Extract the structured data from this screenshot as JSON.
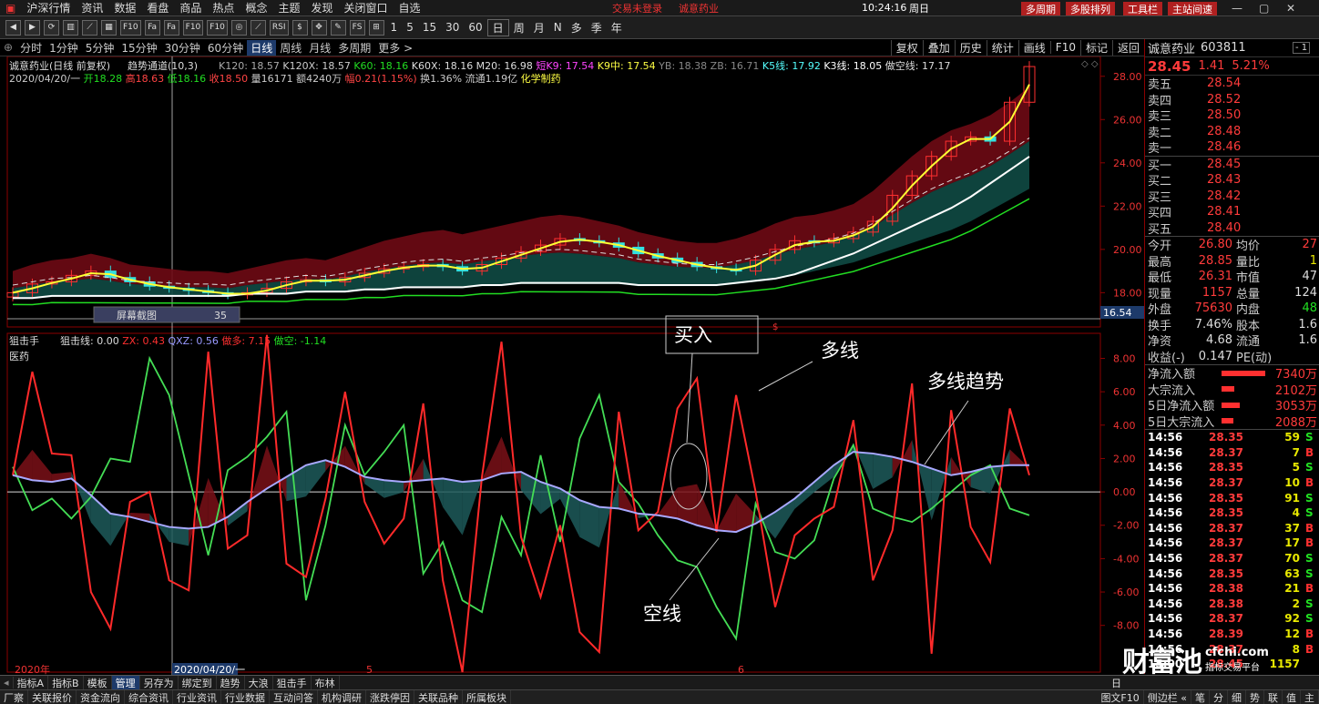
{
  "menu": {
    "items": [
      "沪深行情",
      "资讯",
      "数据",
      "看盘",
      "商品",
      "热点",
      "概念",
      "主题",
      "发现",
      "关闭窗口",
      "自选"
    ],
    "center_notice_1": "交易未登录",
    "center_notice_2": "诚意药业",
    "clock": "10:24:16",
    "weekday": "周日",
    "right_buttons": [
      "多周期",
      "多股排列",
      "工具栏",
      "主站间速"
    ]
  },
  "toolbar": {
    "icons": [
      "back-icon",
      "forward-icon",
      "refresh-icon",
      "candle-icon",
      "line-chart-icon",
      "grid-icon",
      "f10-icon",
      "fa-icon",
      "fa2-icon",
      "f10b-icon",
      "f10c-icon",
      "target-icon",
      "multi-chart-icon",
      "rsi-icon",
      "dollar-icon",
      "move-icon",
      "pencil-icon",
      "fs-icon",
      "cross-icon"
    ],
    "icon_labels": [
      "◀",
      "▶",
      "⟳",
      "▥",
      "⟋",
      "▦",
      "F10",
      "Fa",
      "Fa",
      "F10",
      "F10",
      "◎",
      "⟋",
      "RSI",
      "$",
      "✥",
      "✎",
      "FS",
      "⊞"
    ],
    "numbers": [
      "1",
      "5",
      "15",
      "30",
      "60"
    ],
    "periods": [
      "日",
      "周",
      "月",
      "N",
      "多",
      "季",
      "年"
    ]
  },
  "periodbar": {
    "items": [
      "分时",
      "1分钟",
      "5分钟",
      "15分钟",
      "30分钟",
      "60分钟",
      "日线",
      "周线",
      "月线",
      "多周期",
      "更多 >"
    ],
    "active": "日线",
    "right": [
      "复权",
      "叠加",
      "历史",
      "统计",
      "画线",
      "F10",
      "标记",
      "返回"
    ]
  },
  "main_chart": {
    "title_line": "诚意药业(日线 前复权)",
    "indicator": "趋势通道(10,3)",
    "params": [
      {
        "text": "K120: 18.57",
        "color": "#aaaaaa"
      },
      {
        "text": "K120X: 18.57",
        "color": "#cccccc"
      },
      {
        "text": "K60: 18.16",
        "color": "#22dd22"
      },
      {
        "text": "K60X: 18.16",
        "color": "#dddddd"
      },
      {
        "text": "M20: 16.98",
        "color": "#dddddd"
      },
      {
        "text": "短K9: 17.54",
        "color": "#ff44ff"
      },
      {
        "text": "K9中: 17.54",
        "color": "#ffff44"
      },
      {
        "text": "YB: 18.38",
        "color": "#888888"
      },
      {
        "text": "ZB: 16.71",
        "color": "#888888"
      },
      {
        "text": "K5线: 17.92",
        "color": "#55ffff"
      },
      {
        "text": "K3线: 18.05",
        "color": "#ffffff"
      },
      {
        "text": "做空线: 17.17",
        "color": "#dddddd"
      }
    ],
    "info_line": [
      {
        "text": "2020/04/20/一",
        "color": "#cccccc"
      },
      {
        "text": "开18.28",
        "color": "#22dd22"
      },
      {
        "text": "高18.63",
        "color": "#ff4444"
      },
      {
        "text": "低18.16",
        "color": "#22dd22"
      },
      {
        "text": "收18.50",
        "color": "#ff4444"
      },
      {
        "text": "量16171",
        "color": "#cccccc"
      },
      {
        "text": "额4240万",
        "color": "#cccccc"
      },
      {
        "text": "幅0.21(1.15%)",
        "color": "#ff4444"
      },
      {
        "text": "换1.36%",
        "color": "#cccccc"
      },
      {
        "text": "流通1.19亿",
        "color": "#cccccc"
      },
      {
        "text": "化学制药",
        "color": "#ffff44"
      }
    ],
    "y_ticks": [
      "28.00",
      "26.00",
      "24.00",
      "22.00",
      "20.00",
      "18.00"
    ],
    "cursor_price": "16.54",
    "screenshot_tip": "屏幕截图",
    "screenshot_num": "35"
  },
  "sub_chart": {
    "title": "狙击手",
    "label_2": "医药",
    "params": [
      {
        "text": "狙击线: 0.00",
        "color": "#dddddd"
      },
      {
        "text": "ZX: 0.43",
        "color": "#ff3030"
      },
      {
        "text": "QXZ: 0.56",
        "color": "#9999ff"
      },
      {
        "text": "做多: 7.15",
        "color": "#ff3030"
      },
      {
        "text": "做空: -1.14",
        "color": "#22dd22"
      }
    ],
    "y_ticks": [
      "8.00",
      "6.00",
      "4.00",
      "2.00",
      "0.00",
      "-2.00",
      "-4.00",
      "-6.00",
      "-8.00"
    ],
    "annotations": {
      "buy": "买入",
      "long": "多线",
      "long_trend": "多线趋势",
      "short": "空线"
    }
  },
  "x_axis": {
    "year": "2020年",
    "date": "2020/04/20/一",
    "m5": "5",
    "m6": "6"
  },
  "chart_data": {
    "type": "candlestick",
    "price_ylim": [
      16.5,
      29.0
    ],
    "osc_ylim": [
      -10.8,
      9.5
    ],
    "price_close": [
      18.0,
      18.4,
      18.5,
      18.8,
      19.0,
      18.7,
      18.5,
      18.3,
      18.2,
      18.1,
      18.0,
      17.9,
      18.0,
      18.2,
      18.5,
      18.6,
      18.5,
      18.7,
      18.9,
      19.1,
      19.2,
      19.3,
      19.2,
      19.0,
      19.3,
      19.6,
      19.9,
      20.2,
      20.5,
      20.4,
      20.3,
      20.1,
      19.8,
      19.6,
      19.4,
      19.2,
      19.1,
      19.0,
      19.5,
      20.0,
      20.4,
      20.3,
      20.5,
      20.8,
      21.3,
      22.5,
      23.4,
      24.3,
      25.0,
      25.2,
      25.0,
      26.8,
      28.45
    ],
    "upper_band": [
      19.0,
      19.3,
      19.5,
      19.6,
      19.8,
      19.6,
      19.3,
      19.2,
      19.1,
      19.0,
      19.0,
      18.9,
      19.1,
      19.3,
      19.5,
      19.6,
      19.5,
      19.8,
      20.1,
      20.4,
      20.6,
      20.8,
      20.9,
      20.7,
      20.9,
      21.1,
      21.3,
      21.5,
      21.6,
      21.5,
      21.3,
      21.1,
      20.8,
      20.6,
      20.4,
      20.3,
      20.3,
      20.5,
      20.8,
      21.2,
      21.5,
      21.6,
      21.8,
      22.1,
      22.7,
      23.5,
      24.3,
      25.0,
      25.5,
      25.8,
      26.2,
      26.8,
      27.5
    ],
    "lower_band": [
      17.7,
      17.7,
      17.8,
      17.8,
      17.8,
      17.8,
      17.8,
      17.8,
      17.8,
      17.8,
      17.8,
      17.8,
      17.9,
      17.9,
      17.9,
      18.0,
      18.0,
      18.0,
      18.1,
      18.1,
      18.2,
      18.2,
      18.2,
      18.2,
      18.3,
      18.3,
      18.4,
      18.4,
      18.4,
      18.4,
      18.4,
      18.4,
      18.3,
      18.3,
      18.3,
      18.3,
      18.3,
      18.4,
      18.5,
      18.6,
      18.8,
      19.0,
      19.2,
      19.4,
      19.7,
      20.0,
      20.3,
      20.6,
      20.9,
      21.3,
      21.8,
      22.3,
      22.8
    ],
    "osc_red": [
      1.0,
      7.2,
      2.3,
      2.2,
      -6.0,
      -8.2,
      -0.6,
      0.0,
      -5.3,
      -5.9,
      8.4,
      -3.4,
      -2.6,
      9.4,
      -4.3,
      -5.1,
      -0.4,
      6.0,
      -0.6,
      -3.1,
      -1.6,
      5.3,
      -5.3,
      -10.8,
      0.9,
      9.0,
      -2.7,
      -6.3,
      -2.0,
      -8.4,
      -9.6,
      4.8,
      -2.3,
      -1.2,
      5.0,
      6.8,
      -2.4,
      5.8,
      0.0,
      -6.9,
      -2.6,
      -1.6,
      -0.9,
      4.3,
      -5.3,
      -2.3,
      6.5,
      -9.7,
      4.9,
      -2.1,
      -4.2,
      5.0,
      1.0
    ],
    "osc_green": [
      1.5,
      -1.1,
      -0.4,
      -1.6,
      -0.3,
      2.0,
      1.8,
      8.0,
      5.8,
      1.0,
      -3.8,
      1.3,
      2.1,
      3.3,
      4.8,
      -6.5,
      -2.0,
      4.0,
      1.0,
      2.4,
      4.0,
      -4.9,
      -3.0,
      -6.5,
      -7.2,
      -1.5,
      -3.8,
      2.2,
      -3.0,
      3.2,
      5.8,
      0.6,
      -0.7,
      -2.6,
      -4.1,
      -4.5,
      -6.9,
      -8.8,
      -0.7,
      -3.6,
      -4.0,
      -2.9,
      0.8,
      2.8,
      -1.0,
      -1.5,
      -1.8,
      -1.0,
      0.0,
      1.0,
      1.6,
      -1.0,
      -1.4
    ],
    "osc_trend": [
      1.0,
      0.7,
      0.6,
      0.8,
      -0.2,
      -1.3,
      -1.5,
      -1.8,
      -2.1,
      -2.2,
      -2.1,
      -1.5,
      -0.6,
      0.2,
      0.9,
      1.6,
      1.9,
      1.5,
      0.9,
      0.7,
      0.6,
      0.7,
      0.8,
      0.6,
      0.7,
      1.1,
      1.2,
      0.6,
      0.2,
      -0.5,
      -0.9,
      -1.0,
      -1.3,
      -1.4,
      -1.6,
      -2.0,
      -2.3,
      -2.4,
      -1.9,
      -1.2,
      -0.4,
      0.6,
      1.6,
      2.4,
      2.3,
      2.1,
      1.8,
      1.4,
      1.0,
      1.2,
      1.5,
      1.6,
      1.6
    ]
  },
  "quote": {
    "name": "诚意药业",
    "code": "603811",
    "price": "28.45",
    "change": "1.41",
    "pct": "5.21%",
    "asks": [
      {
        "label": "卖五",
        "price": "28.54"
      },
      {
        "label": "卖四",
        "price": "28.52"
      },
      {
        "label": "卖三",
        "price": "28.50"
      },
      {
        "label": "卖二",
        "price": "28.48"
      },
      {
        "label": "卖一",
        "price": "28.46"
      }
    ],
    "bids": [
      {
        "label": "买一",
        "price": "28.45"
      },
      {
        "label": "买二",
        "price": "28.43"
      },
      {
        "label": "买三",
        "price": "28.42"
      },
      {
        "label": "买四",
        "price": "28.41"
      },
      {
        "label": "买五",
        "price": "28.40"
      }
    ],
    "stats": [
      {
        "l1": "今开",
        "v1": "26.80",
        "c1": "#ff3b3b",
        "l2": "均价",
        "v2": "27",
        "c2": "#ff3b3b"
      },
      {
        "l1": "最高",
        "v1": "28.85",
        "c1": "#ff3b3b",
        "l2": "量比",
        "v2": "1",
        "c2": "#e8e800"
      },
      {
        "l1": "最低",
        "v1": "26.31",
        "c1": "#ff3b3b",
        "l2": "市值",
        "v2": "47",
        "c2": "#dddddd"
      },
      {
        "l1": "现量",
        "v1": "1157",
        "c1": "#ff3b3b",
        "l2": "总量",
        "v2": "124",
        "c2": "#dddddd"
      },
      {
        "l1": "外盘",
        "v1": "75630",
        "c1": "#ff3b3b",
        "l2": "内盘",
        "v2": "48",
        "c2": "#22e022"
      },
      {
        "l1": "换手",
        "v1": "7.46%",
        "c1": "#dddddd",
        "l2": "股本",
        "v2": "1.6",
        "c2": "#dddddd"
      },
      {
        "l1": "净资",
        "v1": "4.68",
        "c1": "#dddddd",
        "l2": "流通",
        "v2": "1.6",
        "c2": "#dddddd"
      },
      {
        "l1": "收益(-)",
        "v1": "0.147",
        "c1": "#dddddd",
        "l2": "PE(动)",
        "v2": "",
        "c2": "#dddddd"
      }
    ],
    "flows": [
      {
        "label": "净流入额",
        "value": "7340万",
        "bar": 1.0
      },
      {
        "label": "大宗流入",
        "value": "2102万",
        "bar": 0.29
      },
      {
        "label": "5日净流入额",
        "value": "3053万",
        "bar": 0.42
      },
      {
        "label": "5日大宗流入",
        "value": "2088万",
        "bar": 0.28
      }
    ],
    "ticks": [
      {
        "t": "14:56",
        "p": "28.35",
        "v": "59",
        "d": "S"
      },
      {
        "t": "14:56",
        "p": "28.37",
        "v": "7",
        "d": "B"
      },
      {
        "t": "14:56",
        "p": "28.35",
        "v": "5",
        "d": "S"
      },
      {
        "t": "14:56",
        "p": "28.37",
        "v": "10",
        "d": "B"
      },
      {
        "t": "14:56",
        "p": "28.35",
        "v": "91",
        "d": "S"
      },
      {
        "t": "14:56",
        "p": "28.35",
        "v": "4",
        "d": "S"
      },
      {
        "t": "14:56",
        "p": "28.37",
        "v": "37",
        "d": "B"
      },
      {
        "t": "14:56",
        "p": "28.37",
        "v": "17",
        "d": "B"
      },
      {
        "t": "14:56",
        "p": "28.37",
        "v": "70",
        "d": "S"
      },
      {
        "t": "14:56",
        "p": "28.35",
        "v": "63",
        "d": "S"
      },
      {
        "t": "14:56",
        "p": "28.38",
        "v": "21",
        "d": "B"
      },
      {
        "t": "14:56",
        "p": "28.38",
        "v": "2",
        "d": "S"
      },
      {
        "t": "14:56",
        "p": "28.37",
        "v": "92",
        "d": "S"
      },
      {
        "t": "14:56",
        "p": "28.39",
        "v": "12",
        "d": "B"
      },
      {
        "t": "14:56",
        "p": "28.37",
        "v": "8",
        "d": "B"
      },
      {
        "t": "15:00",
        "p": "28.45",
        "v": "1157",
        "d": ""
      }
    ],
    "close_btn": "- 1"
  },
  "bottom": {
    "tabs": [
      "指标A",
      "指标B",
      "模板",
      "管理",
      "另存为",
      "绑定到",
      "趋势",
      "大浪",
      "狙击手",
      "布林"
    ],
    "active_tab": "管理",
    "links": [
      "厂察",
      "关联报价",
      "资金流向",
      "综合资讯",
      "行业资讯",
      "行业数据",
      "互动问答",
      "机构调研",
      "涨跌停因",
      "关联品种",
      "所属板块"
    ],
    "right_links": [
      "图文F10",
      "侧边栏 «",
      "笔",
      "分",
      "细",
      "势",
      "联",
      "值",
      "主"
    ],
    "zoom": [
      "日",
      "+",
      "-"
    ]
  },
  "watermark": {
    "brand": "财富池",
    "site": "cfchi.com",
    "sub": "指标交易平台"
  }
}
